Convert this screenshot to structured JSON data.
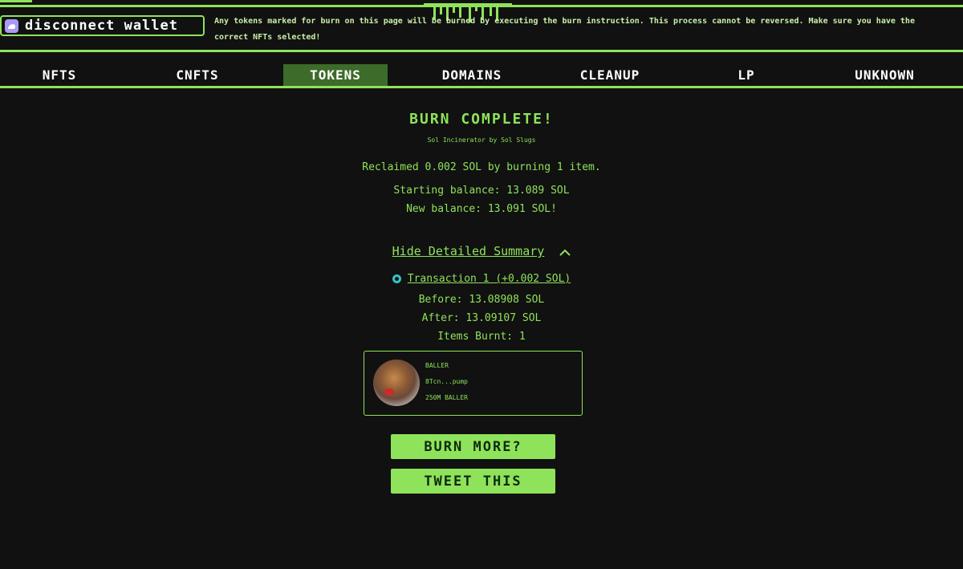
{
  "wallet_button": {
    "label": "disconnect wallet",
    "icon": "phantom-wallet-icon"
  },
  "notice": "Any tokens marked for burn on this page will be burned by executing the burn instruction. This process cannot be reversed. Make sure you have the correct NFTs selected!",
  "tabs": [
    {
      "label": "NFTS",
      "active": false
    },
    {
      "label": "CNFTS",
      "active": false
    },
    {
      "label": "TOKENS",
      "active": true
    },
    {
      "label": "DOMAINS",
      "active": false
    },
    {
      "label": "CLEANUP",
      "active": false
    },
    {
      "label": "LP",
      "active": false
    },
    {
      "label": "UNKNOWN",
      "active": false
    }
  ],
  "result": {
    "title": "BURN COMPLETE!",
    "subtitle": "Sol Incinerator by Sol Slugs",
    "reclaimed": "Reclaimed 0.002 SOL by burning 1 item.",
    "starting_balance": "Starting balance: 13.089 SOL",
    "new_balance": "New balance: 13.091 SOL!"
  },
  "summary": {
    "toggle_label": "Hide Detailed Summary",
    "transaction_label": "Transaction 1 (+0.002 SOL)",
    "before": "Before: 13.08908 SOL",
    "after": "After: 13.09107 SOL",
    "items_burnt": "Items Burnt: 1"
  },
  "item_card": {
    "name": "BALLER",
    "address": "8Tcn...pump",
    "amount": "250M BALLER"
  },
  "buttons": {
    "burn_more": "BURN MORE?",
    "tweet": "TWEET THIS"
  },
  "colors": {
    "accent": "#8ee35a",
    "background": "#111111",
    "active_tab": "#3d6b2a"
  }
}
